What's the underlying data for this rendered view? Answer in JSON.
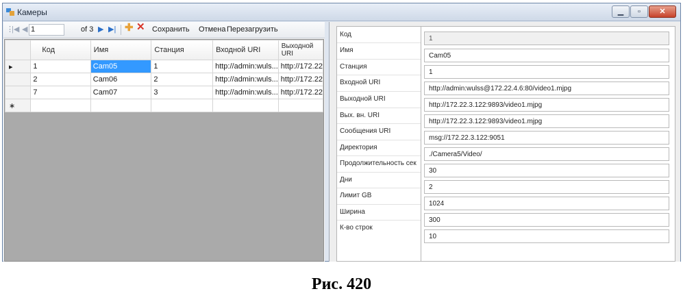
{
  "window": {
    "title": "Камеры"
  },
  "navigator": {
    "position": "1",
    "count_text": "of 3",
    "save_label": "Сохранить",
    "cancel_label": "Отмена",
    "reload_label": "Перезагрузить"
  },
  "grid": {
    "headers": [
      "Код",
      "Имя",
      "Станция",
      "Входной URI",
      "Выходной URI"
    ],
    "rows": [
      [
        "1",
        "Cam05",
        "1",
        "http://admin:wuls...",
        "http://172.22"
      ],
      [
        "2",
        "Cam06",
        "2",
        "http://admin:wuls...",
        "http://172.22"
      ],
      [
        "7",
        "Cam07",
        "3",
        "http://admin:wuls...",
        "http://172.22"
      ]
    ],
    "new_row_marker": "∗",
    "current_row_marker": "▸"
  },
  "details": {
    "fields": [
      {
        "label": "Код",
        "value": "1"
      },
      {
        "label": "Имя",
        "value": "Cam05"
      },
      {
        "label": "Станция",
        "value": "1"
      },
      {
        "label": "Входной URI",
        "value": "http://admin:wulss@172.22.4.6:80/video1.mjpg"
      },
      {
        "label": "Выходной URI",
        "value": "http://172.22.3.122:9893/video1.mjpg"
      },
      {
        "label": "Вых. вн. URI",
        "value": "http://172.22.3.122:9893/video1.mjpg"
      },
      {
        "label": "Сообщения URI",
        "value": "msg://172.22.3.122:9051"
      },
      {
        "label": "Директория",
        "value": "./Camera5/Video/"
      },
      {
        "label": "Продолжительность сек",
        "value": "30"
      },
      {
        "label": "Дни",
        "value": "2"
      },
      {
        "label": "Лимит GB",
        "value": "1024"
      },
      {
        "label": "Ширина",
        "value": "300"
      },
      {
        "label": "К-во строк",
        "value": "10"
      }
    ]
  },
  "caption": "Рис. 420",
  "colors": {
    "selection": "#3399ff",
    "delete": "#d8362a",
    "add": "#e8a23a",
    "nav_arrows": "#2a6fc9"
  }
}
